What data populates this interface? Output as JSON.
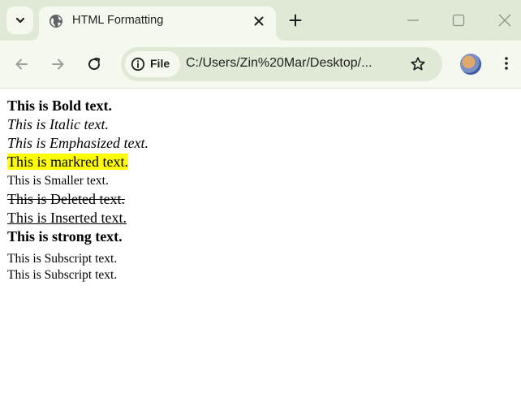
{
  "browser": {
    "tab": {
      "title": "HTML Formatting",
      "favicon": "globe-icon"
    },
    "window_controls": [
      "minimize-icon",
      "maximize-icon",
      "close-icon"
    ],
    "toolbar": {
      "site_chip_label": "File",
      "url": "C:/Users/Zin%20Mar/Desktop/...",
      "icons": [
        "back-arrow-icon",
        "forward-arrow-icon",
        "reload-icon",
        "info-icon",
        "star-icon",
        "avatar",
        "menu-icon"
      ]
    },
    "colors": {
      "frame": "#dfe9d6",
      "tab_active": "#f4f8ef",
      "mark_highlight": "#ffff00"
    }
  },
  "page": {
    "bold": "This is Bold text.",
    "italic": "This is Italic text.",
    "emphasized": "This is Emphasized text.",
    "marked": "This is markred text.",
    "smaller": "This is Smaller text.",
    "deleted": "This is Deleted text.",
    "inserted": "This is Inserted text.",
    "strong": "This is strong text.",
    "subscript_1": "This is Subscript text.",
    "subscript_2": "This is Subscript text."
  }
}
